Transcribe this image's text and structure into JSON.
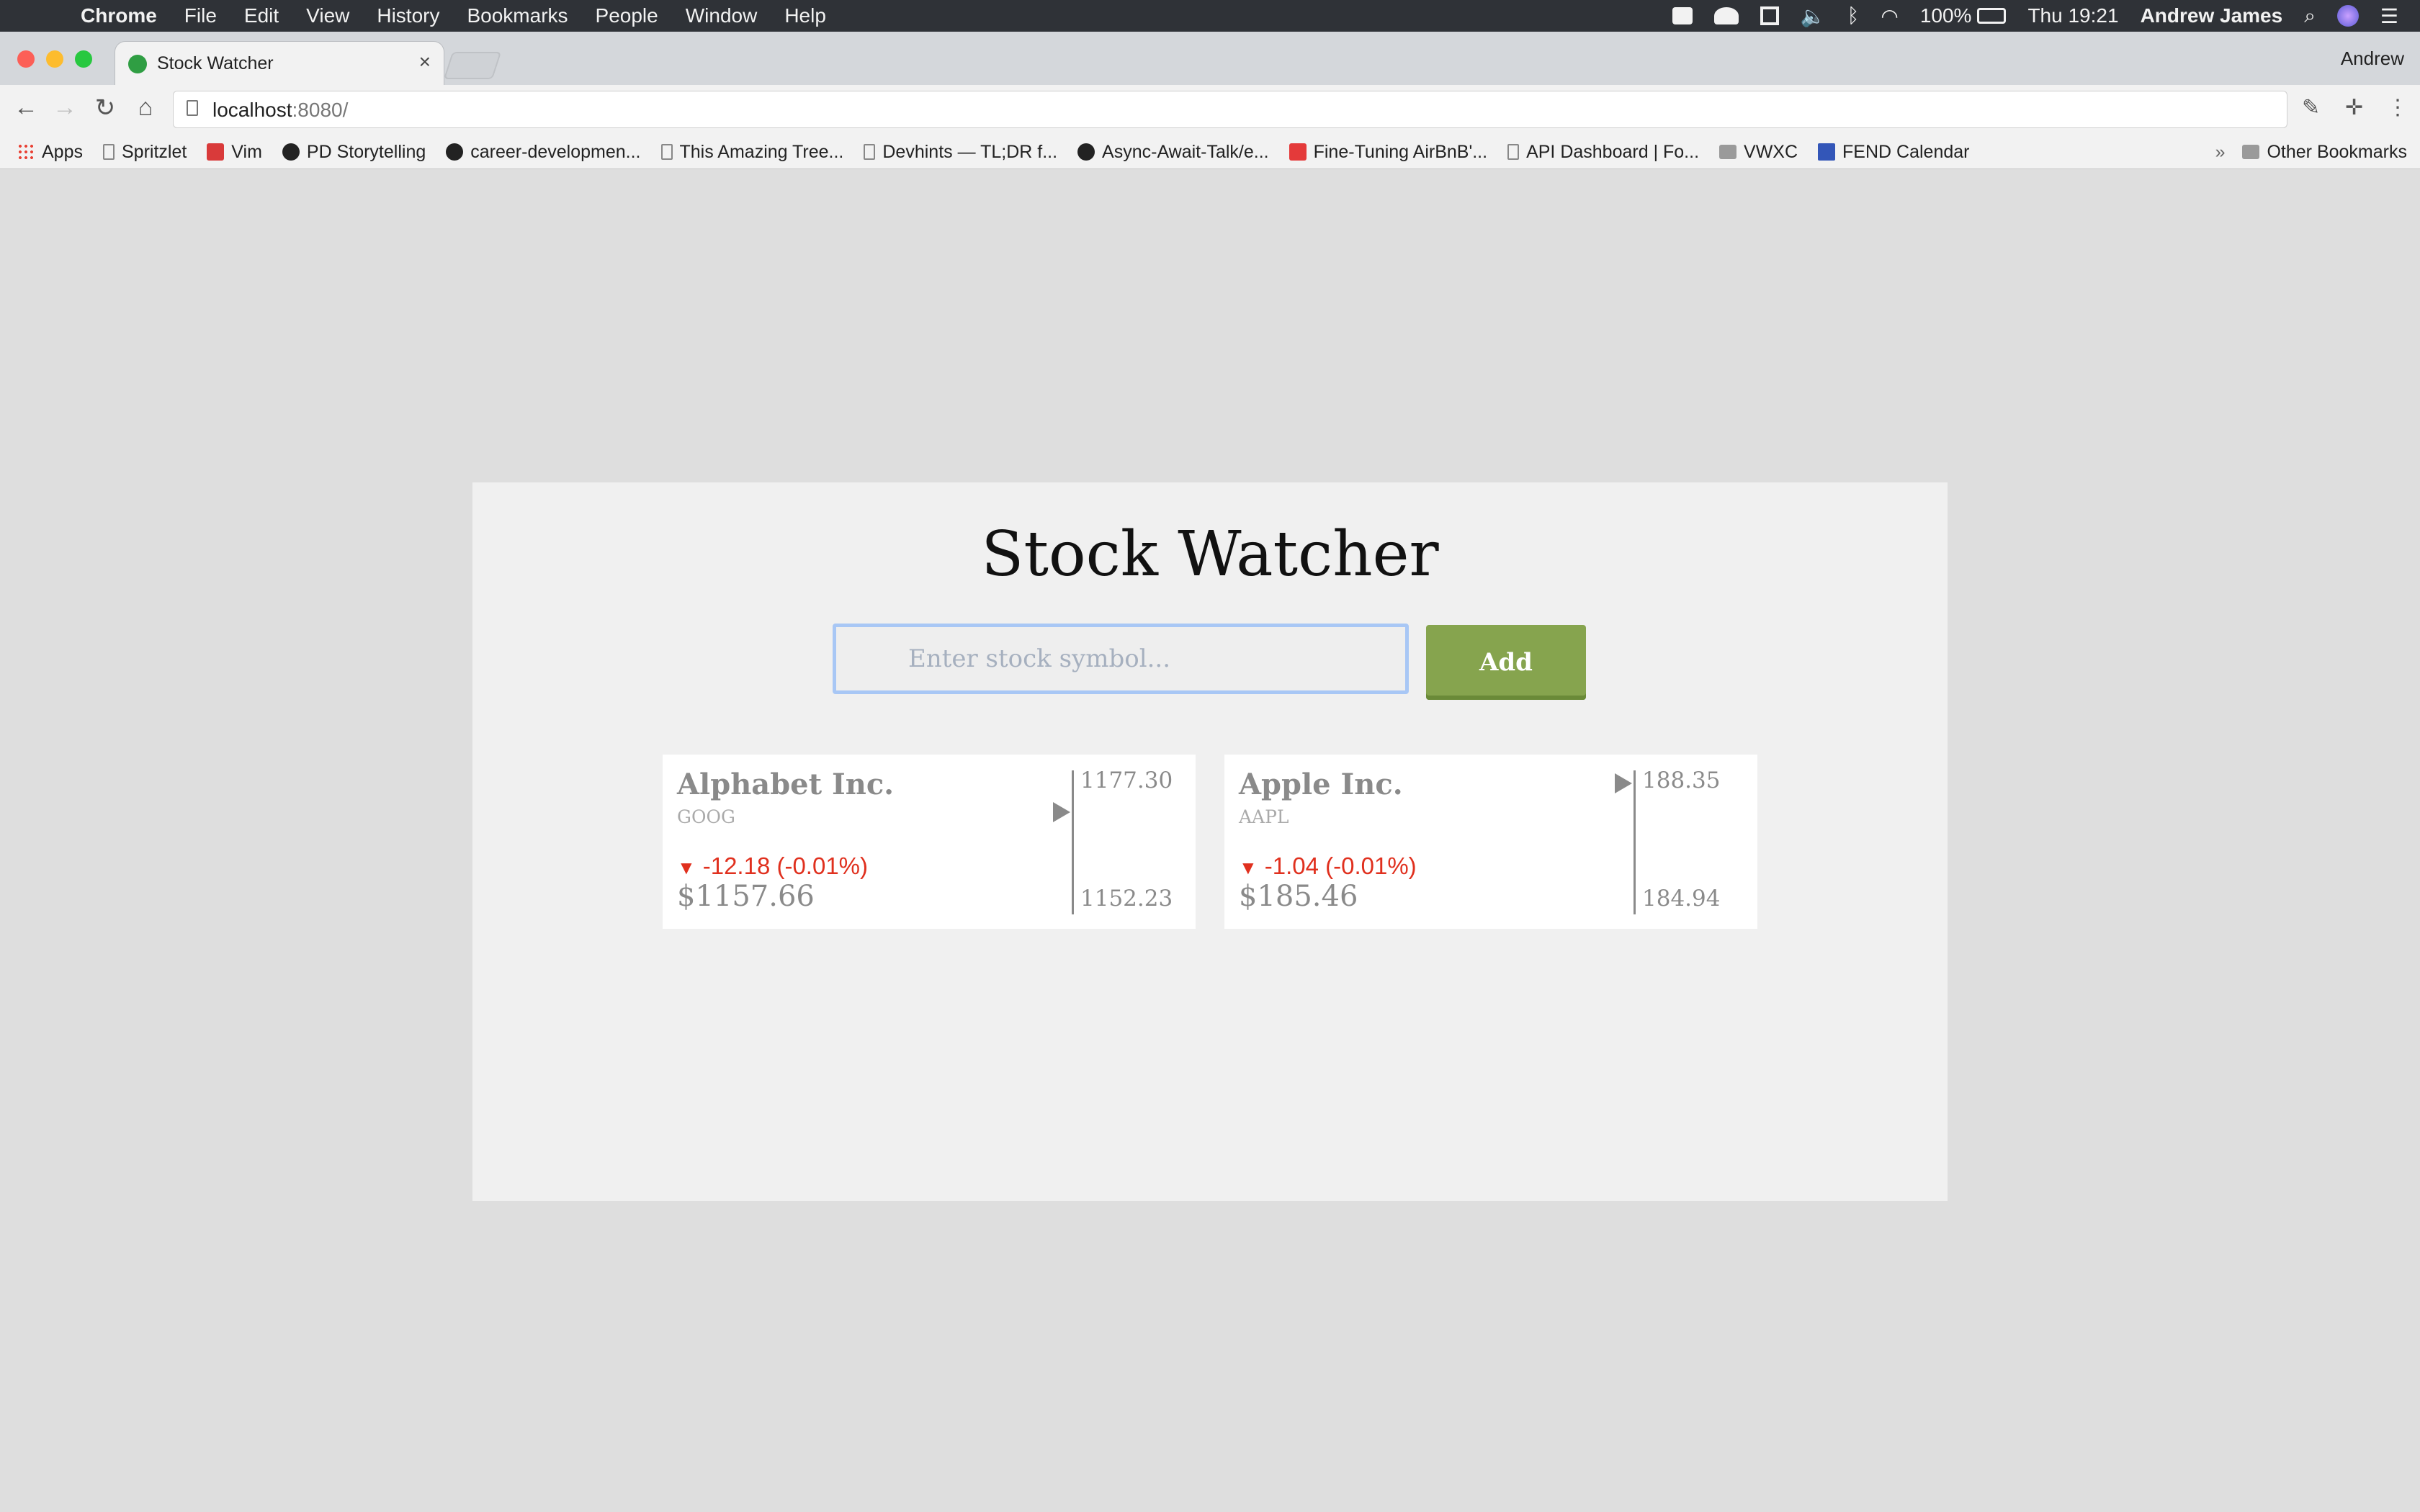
{
  "menubar": {
    "app": "Chrome",
    "items": [
      "File",
      "Edit",
      "View",
      "History",
      "Bookmarks",
      "People",
      "Window",
      "Help"
    ],
    "battery": "100%",
    "clock": "Thu 19:21",
    "user": "Andrew James"
  },
  "tab": {
    "title": "Stock Watcher",
    "close": "×"
  },
  "profile": "Andrew",
  "address": {
    "host": "localhost",
    "port": ":8080/"
  },
  "bookmarks": {
    "items": [
      {
        "label": "Apps",
        "icon": "apps"
      },
      {
        "label": "Spritzlet",
        "icon": "doc"
      },
      {
        "label": "Vim",
        "icon": "vim"
      },
      {
        "label": "PD Storytelling",
        "icon": "gh"
      },
      {
        "label": "career-developmen...",
        "icon": "gh"
      },
      {
        "label": "This Amazing Tree...",
        "icon": "doc"
      },
      {
        "label": "Devhints — TL;DR f...",
        "icon": "doc"
      },
      {
        "label": "Async-Await-Talk/e...",
        "icon": "gh"
      },
      {
        "label": "Fine-Tuning AirBnB'...",
        "icon": "js"
      },
      {
        "label": "API Dashboard | Fo...",
        "icon": "doc"
      },
      {
        "label": "VWXC",
        "icon": "folder"
      },
      {
        "label": "FEND Calendar",
        "icon": "cal"
      }
    ],
    "overflow": "»",
    "other": "Other Bookmarks"
  },
  "app": {
    "title": "Stock Watcher",
    "input_placeholder": "Enter stock symbol...",
    "add_label": "Add"
  },
  "stocks": [
    {
      "name": "Alphabet Inc.",
      "ticker": "GOOG",
      "arrow": "▼",
      "change": "-12.18 (-0.01%)",
      "price": "$1157.66",
      "high": "1177.30",
      "low": "1152.23"
    },
    {
      "name": "Apple Inc.",
      "ticker": "AAPL",
      "arrow": "▼",
      "change": "-1.04 (-0.01%)",
      "price": "$185.46",
      "high": "188.35",
      "low": "184.94"
    }
  ],
  "colors": {
    "accent": "#86a44e",
    "negative": "#e0301e",
    "focus_ring": "#a8c7f5"
  }
}
